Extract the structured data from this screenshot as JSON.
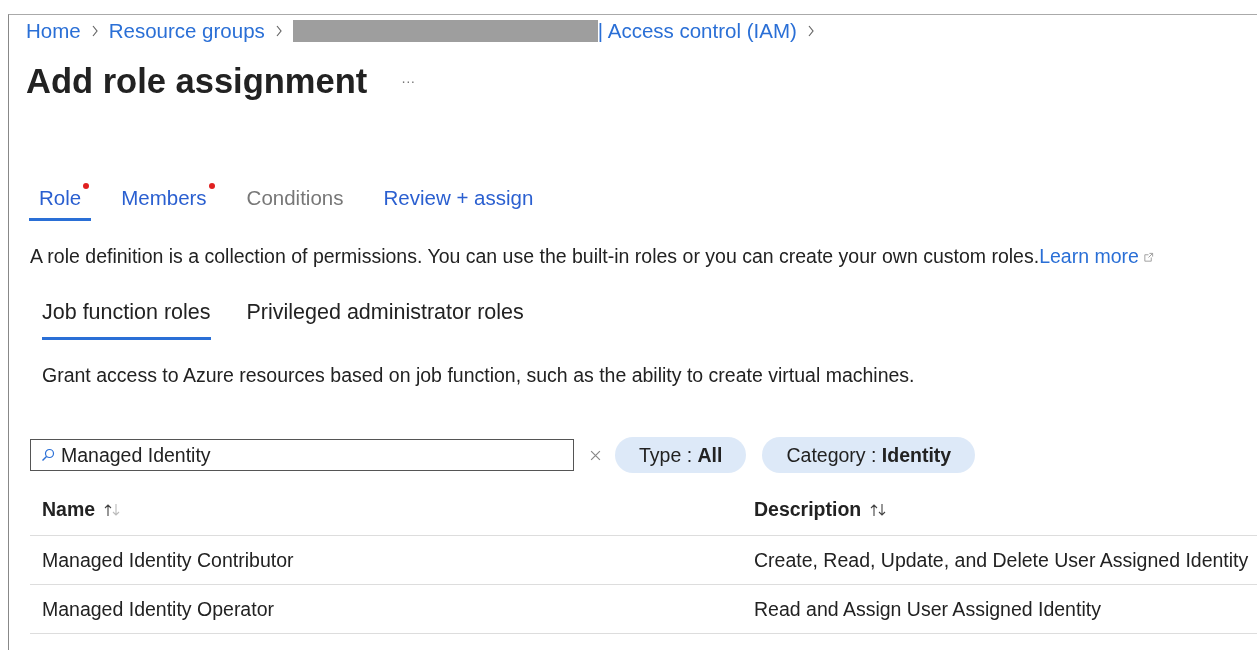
{
  "breadcrumb": [
    {
      "label": "Home",
      "kind": "link"
    },
    {
      "label": "Resource groups",
      "kind": "link"
    },
    {
      "kind": "redacted"
    },
    {
      "label": "| Access control (IAM)",
      "kind": "link"
    }
  ],
  "title": "Add role assignment",
  "more_button": "···",
  "tabs": [
    {
      "label": "Role",
      "selected": true,
      "required": true,
      "disabled": false
    },
    {
      "label": "Members",
      "selected": false,
      "required": true,
      "disabled": false
    },
    {
      "label": "Conditions",
      "selected": false,
      "required": false,
      "disabled": true
    },
    {
      "label": "Review + assign",
      "selected": false,
      "required": false,
      "disabled": false
    }
  ],
  "intro": "A role definition is a collection of permissions. You can use the built-in roles or you can create your own custom roles.",
  "learn_more": "Learn more",
  "subtabs": [
    {
      "label": "Job function roles",
      "selected": true
    },
    {
      "label": "Privileged administrator roles",
      "selected": false
    }
  ],
  "subtab_description": "Grant access to Azure resources based on job function, such as the ability to create virtual machines.",
  "search": {
    "value": "Managed Identity"
  },
  "filters": [
    {
      "label": "Type : ",
      "value": "All"
    },
    {
      "label": "Category : ",
      "value": "Identity"
    }
  ],
  "table": {
    "columns": [
      "Name",
      "Description"
    ],
    "rows": [
      [
        "Managed Identity Contributor",
        "Create, Read, Update, and Delete User Assigned Identity"
      ],
      [
        "Managed Identity Operator",
        "Read and Assign User Assigned Identity"
      ]
    ]
  }
}
